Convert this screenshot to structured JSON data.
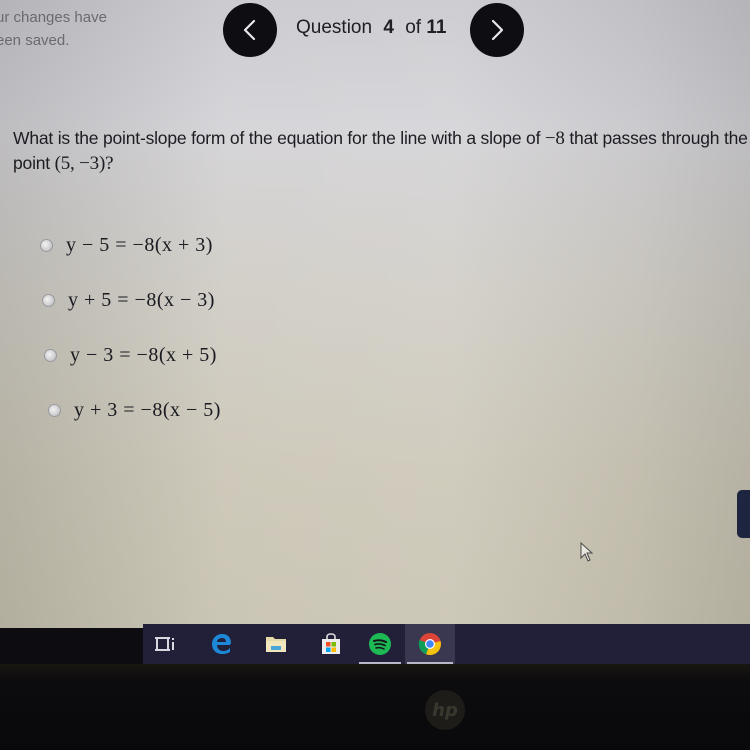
{
  "save_status": {
    "line1": "ur changes have",
    "line2": "een saved."
  },
  "navigation": {
    "prev_icon": "chevron-left-icon",
    "next_icon": "chevron-right-icon",
    "question_word": "Question",
    "current": "4",
    "of_word": "of",
    "total": "11"
  },
  "question": {
    "text_part1": "What is the point-slope form of the equation for the line with a slope of ",
    "slope": "−8",
    "text_part2": " that passes through the point ",
    "point": "(5, −3)",
    "text_part3": "?"
  },
  "options": [
    {
      "label": "y − 5 = −8(x + 3)",
      "selected": false
    },
    {
      "label": "y + 5 = −8(x − 3)",
      "selected": false
    },
    {
      "label": "y − 3 = −8(x + 5)",
      "selected": false
    },
    {
      "label": "y + 3 = −8(x − 5)",
      "selected": false
    }
  ],
  "taskbar": {
    "items": [
      {
        "name": "task-view",
        "icon": "task-view-icon"
      },
      {
        "name": "edge",
        "icon": "edge-icon"
      },
      {
        "name": "file-explorer",
        "icon": "folder-icon"
      },
      {
        "name": "store",
        "icon": "store-icon"
      },
      {
        "name": "spotify",
        "icon": "spotify-icon"
      },
      {
        "name": "chrome",
        "icon": "chrome-icon",
        "active": true
      }
    ]
  },
  "device": {
    "brand": "hp"
  },
  "colors": {
    "nav_button": "#0e0e12",
    "taskbar": "#221f38",
    "edge": "#1e88d8",
    "spotify": "#1db954"
  }
}
